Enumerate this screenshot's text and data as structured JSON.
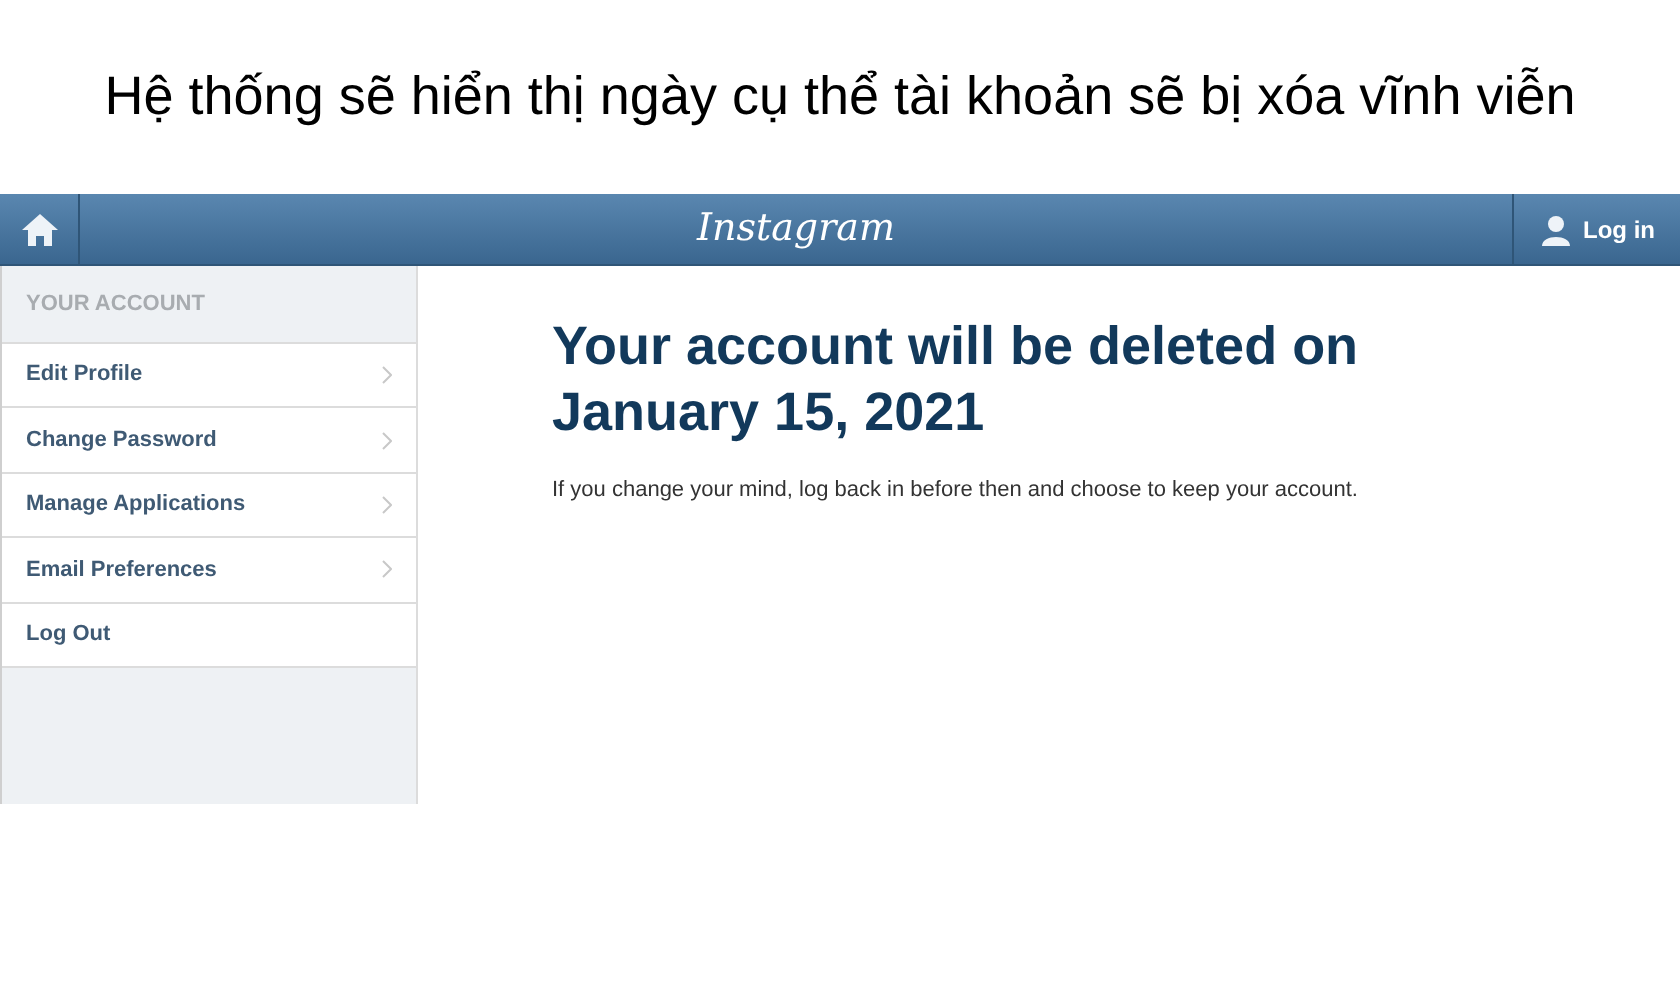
{
  "caption": "Hệ thống sẽ hiển thị ngày cụ thể tài khoản sẽ bị xóa vĩnh viễn",
  "header": {
    "title": "Instagram",
    "login": "Log in"
  },
  "sidebar": {
    "heading": "YOUR ACCOUNT",
    "items": [
      {
        "label": "Edit Profile",
        "has_arrow": true
      },
      {
        "label": "Change Password",
        "has_arrow": true
      },
      {
        "label": "Manage Applications",
        "has_arrow": true
      },
      {
        "label": "Email Preferences",
        "has_arrow": true
      },
      {
        "label": "Log Out",
        "has_arrow": false
      }
    ]
  },
  "main": {
    "heading": "Your account will be deleted on January 15, 2021",
    "note": "If you change your mind, log back in before then and choose to keep your account."
  }
}
